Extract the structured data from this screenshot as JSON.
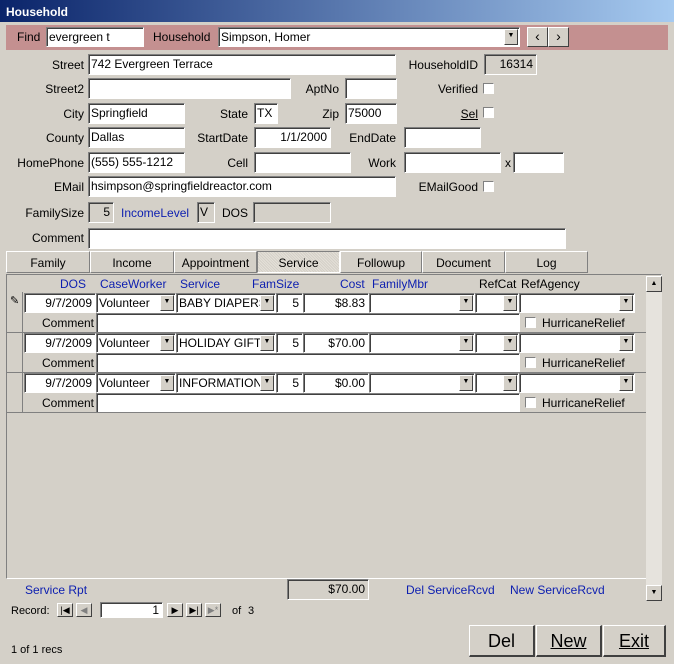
{
  "window": {
    "title": "Household"
  },
  "findbar": {
    "find_label": "Find",
    "find_value": "evergreen t",
    "household_label": "Household",
    "household_value": "Simpson, Homer",
    "prev_glyph": "‹",
    "next_glyph": "›"
  },
  "labels": {
    "street": "Street",
    "street2": "Street2",
    "city": "City",
    "county": "County",
    "homephone": "HomePhone",
    "email": "EMail",
    "familysize": "FamilySize",
    "comment": "Comment",
    "householdid": "HouseholdID",
    "aptno": "AptNo",
    "verified": "Verified",
    "state": "State",
    "zip": "Zip",
    "sel": "Sel",
    "startdate": "StartDate",
    "enddate": "EndDate",
    "cell": "Cell",
    "work": "Work",
    "x": "x",
    "emailgood": "EMailGood",
    "incomelevel": "IncomeLevel",
    "dos": "DOS"
  },
  "values": {
    "street": "742 Evergreen Terrace",
    "street2": "",
    "city": "Springfield",
    "county": "Dallas",
    "homephone": "(555) 555-1212",
    "email": "hsimpson@springfieldreactor.com",
    "familysize": "5",
    "comment": "",
    "householdid": "16314",
    "aptno": "",
    "state": "TX",
    "zip": "75000",
    "startdate": "1/1/2000",
    "enddate": "",
    "cell": "",
    "work": "",
    "ext": "",
    "incomelevel": "V",
    "dos": ""
  },
  "tabs": [
    {
      "label": "Family"
    },
    {
      "label": "Income"
    },
    {
      "label": "Appointment"
    },
    {
      "label": "Service"
    },
    {
      "label": "Followup"
    },
    {
      "label": "Document"
    },
    {
      "label": "Log"
    }
  ],
  "grid": {
    "headers": {
      "dos": "DOS",
      "caseworker": "CaseWorker",
      "service": "Service",
      "famsize": "FamSize",
      "cost": "Cost",
      "familymbr": "FamilyMbr",
      "refcat": "RefCat",
      "refagency": "RefAgency"
    },
    "comment_label": "Comment",
    "hurricane_label": "HurricaneRelief",
    "rows": [
      {
        "dos": "9/7/2009",
        "caseworker": "Volunteer",
        "service": "BABY DIAPERS",
        "famsize": "5",
        "cost": "$8.83",
        "familymbr": "",
        "refcat": "",
        "refagency": "",
        "comment": ""
      },
      {
        "dos": "9/7/2009",
        "caseworker": "Volunteer",
        "service": "HOLIDAY GIFT",
        "famsize": "5",
        "cost": "$70.00",
        "familymbr": "",
        "refcat": "",
        "refagency": "",
        "comment": ""
      },
      {
        "dos": "9/7/2009",
        "caseworker": "Volunteer",
        "service": "INFORMATION",
        "famsize": "5",
        "cost": "$0.00",
        "familymbr": "",
        "refcat": "",
        "refagency": "",
        "comment": ""
      }
    ],
    "edit_glyph": "✎"
  },
  "footer": {
    "service_rpt": "Service Rpt",
    "total": "$70.00",
    "del_servicercvd": "Del ServiceRcvd",
    "new_servicercvd": "New ServiceRcvd"
  },
  "record_nav": {
    "label": "Record:",
    "current": "1",
    "of_label": "of",
    "total": "3",
    "first": "|◀",
    "prev": "◀",
    "next": "▶",
    "last": "▶|",
    "new": "▶*"
  },
  "status": {
    "text": "1 of 1 recs"
  },
  "buttons": {
    "del": "Del",
    "new": "New",
    "exit": "Exit"
  },
  "icons": {
    "dropdown": "▼",
    "scroll_up": "▲",
    "scroll_down": "▼"
  }
}
